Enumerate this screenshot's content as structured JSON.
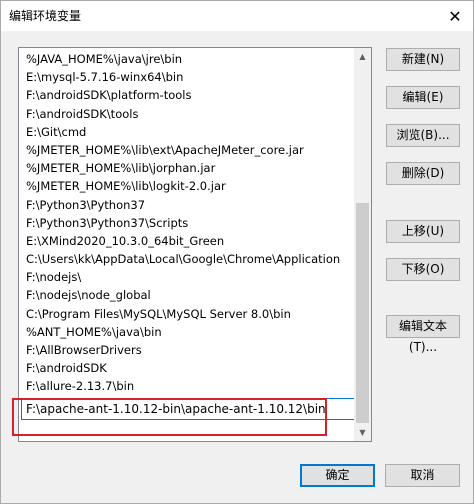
{
  "window": {
    "title": "编辑环境变量",
    "close_glyph": "✕"
  },
  "list": {
    "items": [
      "%JAVA_HOME%\\java\\jre\\bin",
      "E:\\mysql-5.7.16-winx64\\bin",
      "F:\\androidSDK\\platform-tools",
      "F:\\androidSDK\\tools",
      "E:\\Git\\cmd",
      "%JMETER_HOME%\\lib\\ext\\ApacheJMeter_core.jar",
      "%JMETER_HOME%\\lib\\jorphan.jar",
      "%JMETER_HOME%\\lib\\logkit-2.0.jar",
      "F:\\Python3\\Python37",
      "F:\\Python3\\Python37\\Scripts",
      "E:\\XMind2020_10.3.0_64bit_Green",
      "C:\\Users\\kk\\AppData\\Local\\Google\\Chrome\\Application",
      "F:\\nodejs\\",
      "F:\\nodejs\\node_global",
      "C:\\Program Files\\MySQL\\MySQL Server 8.0\\bin",
      "%ANT_HOME%\\java\\bin",
      "F:\\AllBrowserDrivers",
      "F:\\androidSDK",
      "F:\\allure-2.13.7\\bin"
    ],
    "editing_value": "F:\\apache-ant-1.10.12-bin\\apache-ant-1.10.12\\bin"
  },
  "buttons": {
    "new": "新建(N)",
    "edit": "编辑(E)",
    "browse": "浏览(B)...",
    "delete": "删除(D)",
    "move_up": "上移(U)",
    "move_down": "下移(O)",
    "edit_text": "编辑文本(T)...",
    "ok": "确定",
    "cancel": "取消"
  },
  "icons": {
    "close": "close-icon",
    "scroll_up": "chevron-up-icon",
    "scroll_down": "chevron-down-icon"
  },
  "colors": {
    "focus": "#0078d7",
    "highlight": "#d8202a"
  }
}
